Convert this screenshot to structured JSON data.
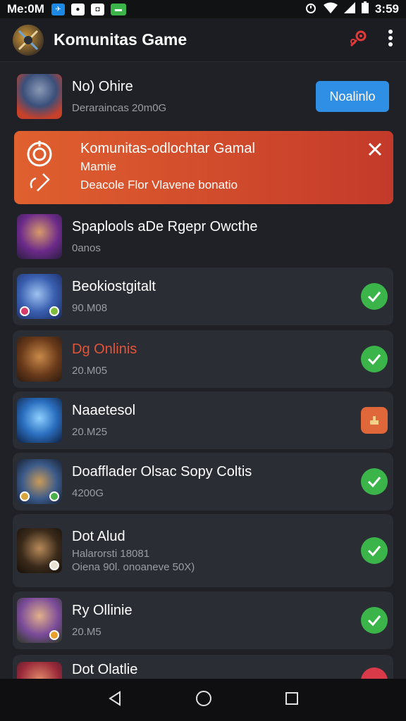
{
  "status_bar": {
    "time": "Me:0M",
    "clock_right": "3:59",
    "icons": [
      "signal-icon",
      "wifi-icon",
      "battery-icon"
    ]
  },
  "app_bar": {
    "title": "Komunitas Game",
    "actions": [
      "settings-gear-icon",
      "more-vert-icon"
    ]
  },
  "featured": {
    "title": "No) Ohire",
    "subtitle": "Deraraincas 20m0G",
    "button_label": "Noalinlo"
  },
  "banner": {
    "title": "Komunitas-odlochtar Gamal",
    "subtitle": "Mamie",
    "description": "Deacole Flor Vlavene bonatio",
    "color": "#d34a2c"
  },
  "games": [
    {
      "title": "Spaplools aDe Rgepr Owcthe",
      "subtitle": "0anos",
      "status": "none"
    },
    {
      "title": "Beokiostgitalt",
      "subtitle": "90.M08",
      "status": "check"
    },
    {
      "title": "Dg Onlinis",
      "subtitle": "20.M05",
      "status": "check",
      "title_color": "#e0553a"
    },
    {
      "title": "Naaetesol",
      "subtitle": "20.M25",
      "status": "warning"
    },
    {
      "title": "Doafflader Olsac Sopy Coltis",
      "subtitle": "4200G",
      "status": "check"
    },
    {
      "title": "Dot Alud",
      "subtitle": "Halarorsti 18081",
      "subtitle2": "Oiena 90l. onoaneve 50X)",
      "status": "check"
    },
    {
      "title": "Ry Ollinie",
      "subtitle": "20.M5",
      "status": "check"
    },
    {
      "title": "Dot Olatlie",
      "subtitle": "",
      "status": "partial"
    }
  ],
  "nav": [
    "back-icon",
    "home-icon",
    "recents-icon"
  ],
  "colors": {
    "accent": "#2e8fe5",
    "check": "#3bb54a",
    "warning": "#e0673a",
    "background": "#1f2127",
    "card": "#2b2d34"
  }
}
